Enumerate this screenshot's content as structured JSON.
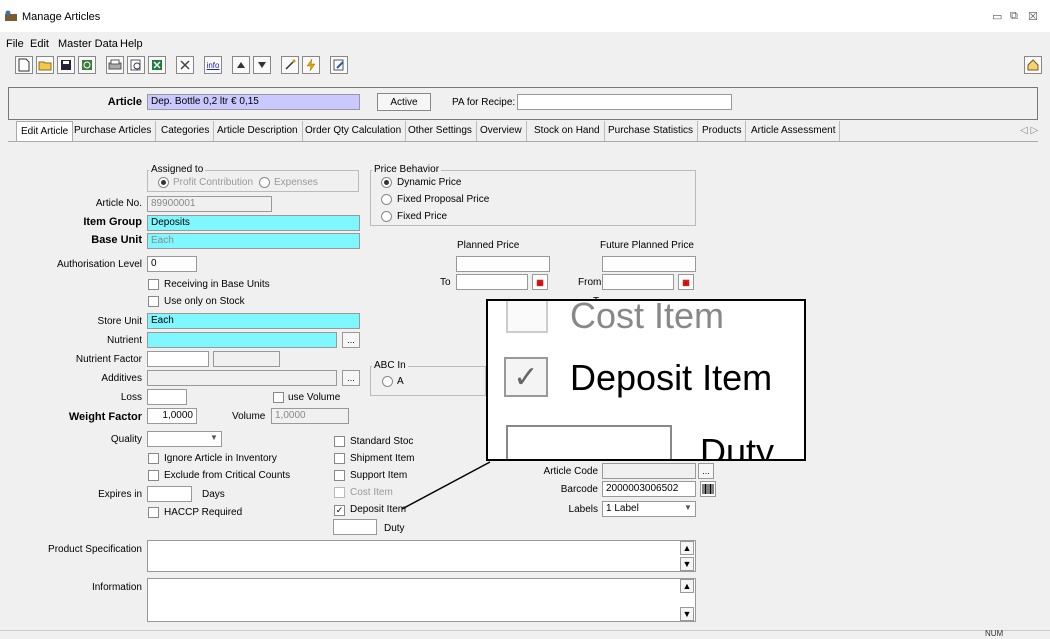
{
  "window": {
    "title": "Manage Articles",
    "min": "▭",
    "max": "⧉",
    "close": "☒"
  },
  "menu": [
    "File",
    "Edit",
    "Master Data",
    "Help"
  ],
  "header": {
    "article_label": "Article",
    "article_value": "Dep. Bottle 0,2 ltr € 0,15",
    "active_label": "Active",
    "pa_label": "PA for Recipe:",
    "pa_value": ""
  },
  "tabs": [
    "Edit Article",
    "Purchase Articles",
    "Categories",
    "Article Description",
    "Order Qty Calculation",
    "Other Settings",
    "Overview",
    "Stock on Hand",
    "Purchase Statistics",
    "Products",
    "Article Assessment"
  ],
  "tab_nav": "◁ ▷",
  "form": {
    "assigned_to_title": "Assigned to",
    "profit_contribution": "Profit Contribution",
    "expenses": "Expenses",
    "article_no_label": "Article No.",
    "article_no_value": "89900001",
    "item_group_label": "Item Group",
    "item_group_value": "Deposits",
    "base_unit_label": "Base Unit",
    "base_unit_value": "Each",
    "auth_level_label": "Authorisation Level",
    "auth_level_value": "0",
    "receiving_base": "Receiving in Base Units",
    "use_only_stock": "Use only on Stock",
    "store_unit_label": "Store Unit",
    "store_unit_value": "Each",
    "nutrient_label": "Nutrient",
    "nutrient_factor_label": "Nutrient Factor",
    "additives_label": "Additives",
    "loss_label": "Loss",
    "use_volume": "use Volume",
    "weight_factor_label": "Weight Factor",
    "weight_factor_value": "1,0000",
    "volume_label": "Volume",
    "volume_value": "1,0000",
    "quality_label": "Quality",
    "ignore_inventory": "Ignore Article in Inventory",
    "exclude_critical": "Exclude from Critical Counts",
    "expires_label": "Expires in",
    "days_label": "Days",
    "haccp": "HACCP Required",
    "standard_stock": "Standard Stoc",
    "shipment_item": "Shipment Item",
    "support_item": "Support Item",
    "cost_item": "Cost Item",
    "deposit_item": "Deposit Item",
    "duty_label": "Duty",
    "abc_label": "ABC In",
    "abc_a": "A",
    "product_spec_label": "Product Specification",
    "information_label": "Information",
    "ellipsis": "..."
  },
  "price": {
    "title": "Price Behavior",
    "dynamic": "Dynamic Price",
    "fixed_proposal": "Fixed Proposal Price",
    "fixed": "Fixed Price",
    "planned_label": "Planned Price",
    "future_label": "Future Planned Price",
    "to_label": "To",
    "from_label": "From",
    "to2_label": "T"
  },
  "codes": {
    "article_code_label": "Article Code",
    "barcode_label": "Barcode",
    "barcode_value": "2000003006502",
    "labels_label": "Labels",
    "labels_value": "1 Label"
  },
  "zoom": {
    "cost_item": "Cost Item",
    "deposit_item": "Deposit Item",
    "duty": "Duty"
  },
  "status": {
    "num": "NUM"
  },
  "icons": [
    "new-icon",
    "open-icon",
    "save-icon",
    "refresh-icon",
    "print-icon",
    "print-preview-icon",
    "excel-icon",
    "delete-icon",
    "info-icon",
    "up-icon",
    "down-icon",
    "wand-icon",
    "lightning-icon",
    "edit-icon",
    "home-icon"
  ]
}
